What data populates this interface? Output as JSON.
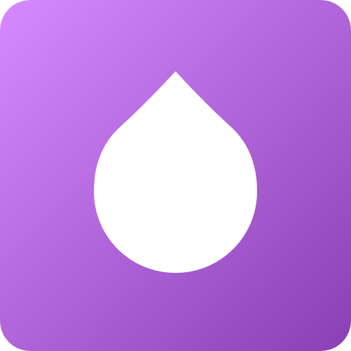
{
  "icon": {
    "name": "droplet-icon",
    "background_gradient": {
      "start": "#D58BFF",
      "end": "#8A3FB3"
    },
    "glyph_color": "#FFFFFF"
  }
}
